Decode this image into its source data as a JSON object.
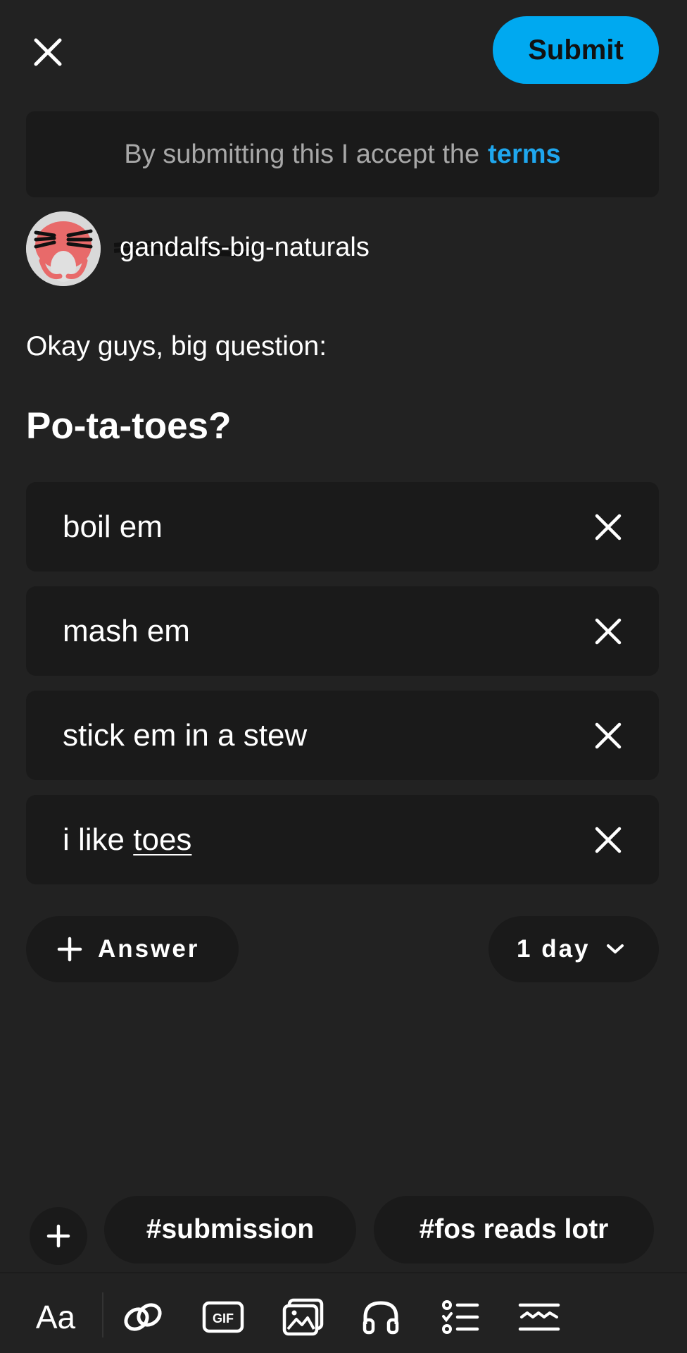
{
  "header": {
    "close_icon": "close-icon",
    "submit_label": "Submit"
  },
  "terms": {
    "prefix": "By submitting this I accept the",
    "link": "terms"
  },
  "author": {
    "username": "gandalfs-big-naturals"
  },
  "post": {
    "question": "Okay guys, big question:",
    "poll_title": "Po-ta-toes?"
  },
  "answers": [
    {
      "text": "boil em"
    },
    {
      "text": "mash em"
    },
    {
      "text": "stick em in a stew"
    },
    {
      "text_prefix": "i like ",
      "text_underlined": "toes"
    }
  ],
  "controls": {
    "add_answer_label": "Answer",
    "duration_label": "1 day"
  },
  "tags": [
    "#submission",
    "#fos reads lotr"
  ],
  "toolbar": {
    "text_format_label": "Aa",
    "icons": [
      "text-format-icon",
      "link-icon",
      "gif-icon",
      "image-icon",
      "audio-icon",
      "list-icon",
      "divider-icon"
    ]
  },
  "colors": {
    "background": "#222222",
    "card": "#1a1a1a",
    "accent": "#00a9f0",
    "link": "#1fa7ee"
  }
}
